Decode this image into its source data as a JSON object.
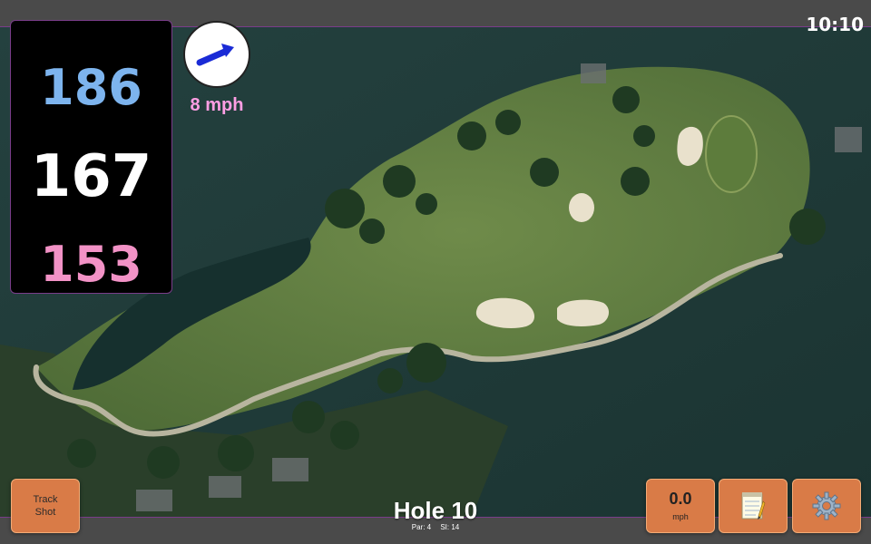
{
  "status": {
    "time": "10:10"
  },
  "distances": {
    "back": "186",
    "middle": "167",
    "front": "153"
  },
  "wind": {
    "speed_text": "8 mph",
    "icon": "wind-arrow-icon",
    "direction": "up-right"
  },
  "hole": {
    "title": "Hole 10",
    "par": "Par: 4",
    "stroke_index": "SI: 14"
  },
  "controls": {
    "track_shot_line1": "Track",
    "track_shot_line2": "Shot",
    "speed_value": "0.0",
    "speed_unit": "mph",
    "notes_icon": "notepad-icon",
    "settings_icon": "gear-icon"
  },
  "colors": {
    "back": "#7db4ee",
    "middle": "#ffffff",
    "front": "#f292c6",
    "wind_text": "#ff9ee4",
    "button": "#d97b47",
    "panel_border": "#7a3d8a"
  }
}
